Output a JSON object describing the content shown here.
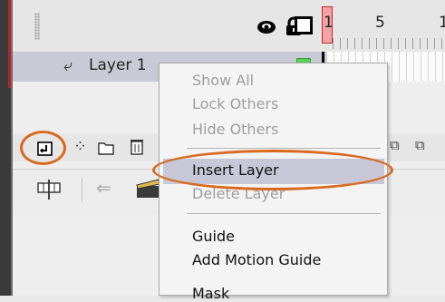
{
  "timeline": {
    "frame_numbers": [
      "1",
      "5",
      "1"
    ],
    "layer_name": "Layer 1"
  },
  "context_menu": {
    "items": [
      {
        "label": "Show All",
        "enabled": false
      },
      {
        "label": "Lock Others",
        "enabled": false
      },
      {
        "label": "Hide Others",
        "enabled": false
      },
      {
        "label": "Insert Layer",
        "enabled": true,
        "highlighted": true
      },
      {
        "label": "Delete Layer",
        "enabled": false
      },
      {
        "label": "Guide",
        "enabled": true
      },
      {
        "label": "Add Motion Guide",
        "enabled": true
      },
      {
        "label": "Mask",
        "enabled": true
      }
    ]
  },
  "icons": {
    "eye": "eye-icon",
    "lock": "lock-icon",
    "outline": "outline-icon",
    "new_layer": "new-layer-icon",
    "motion_guide": "add-motion-guide-icon",
    "folder": "new-folder-icon",
    "trash": "trash-icon"
  },
  "colors": {
    "annotation": "#d86a1f",
    "menu_highlight": "#c8c7d7",
    "layer_row": "#c8cad6",
    "playhead": "#f3a3a6"
  }
}
